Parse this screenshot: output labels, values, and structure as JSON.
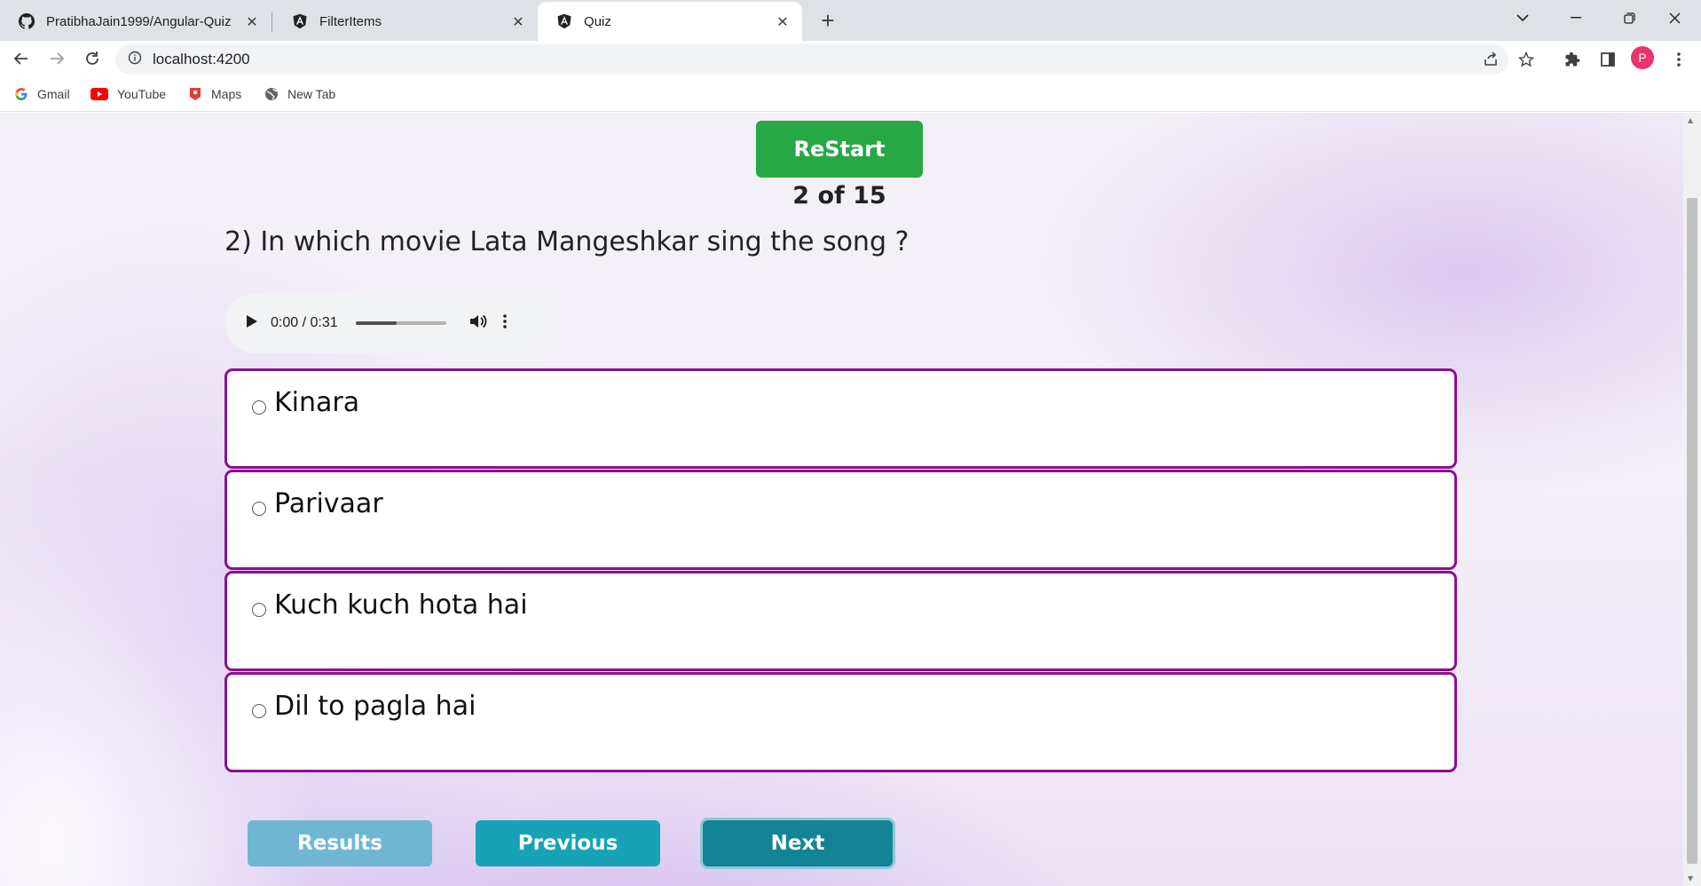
{
  "browser": {
    "tabs": [
      {
        "title": "PratibhaJain1999/Angular-Quiz",
        "icon": "github-icon"
      },
      {
        "title": "FilterItems",
        "icon": "angular-icon"
      },
      {
        "title": "Quiz",
        "icon": "angular-icon",
        "active": true
      }
    ],
    "url": "localhost:4200",
    "profile_initial": "P",
    "bookmarks": [
      {
        "label": "Gmail",
        "icon": "google-icon"
      },
      {
        "label": "YouTube",
        "icon": "youtube-icon"
      },
      {
        "label": "Maps",
        "icon": "maps-icon"
      },
      {
        "label": "New Tab",
        "icon": "globe-icon"
      }
    ]
  },
  "quiz": {
    "restart_label": "ReStart",
    "counter": "2 of 15",
    "question": "2) In which movie Lata Mangeshkar sing the song ?",
    "audio": {
      "time": "0:00 / 0:31",
      "buffered_fraction": 0.45
    },
    "options": [
      "Kinara",
      "Parivaar",
      "Kuch kuch hota hai",
      "Dil to pagla hai"
    ],
    "buttons": {
      "results": "Results",
      "previous": "Previous",
      "next": "Next"
    }
  },
  "colors": {
    "option_border": "#8b0f8f",
    "restart_bg": "#28a745",
    "results_bg": "#6fb6d3",
    "previous_bg": "#17a2b8",
    "next_bg": "#138496",
    "profile_avatar": "#e8336d"
  }
}
